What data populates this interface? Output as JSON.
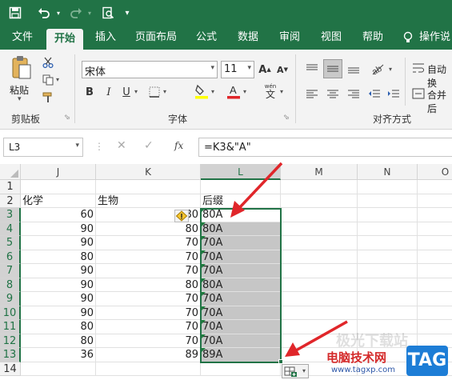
{
  "qat": {
    "icons": [
      "save-icon",
      "undo-icon",
      "redo-icon",
      "print-preview-icon",
      "customize-icon"
    ]
  },
  "tabs": [
    "文件",
    "开始",
    "插入",
    "页面布局",
    "公式",
    "数据",
    "审阅",
    "视图",
    "帮助",
    "操作说"
  ],
  "ribbon": {
    "clipboard": {
      "paste_label": "粘贴",
      "group_label": "剪贴板"
    },
    "font": {
      "font_name": "宋体",
      "font_size": "11",
      "group_label": "字体",
      "bold": "B",
      "italic": "I",
      "underline": "U",
      "wen": "wén",
      "wen_char": "文",
      "grow": "A",
      "shrink": "A"
    },
    "alignment": {
      "wrap_label": "自动换",
      "merge_label": "合并后",
      "group_label": "对齐方式"
    }
  },
  "formula_bar": {
    "name_box": "L3",
    "fx": "fx",
    "formula": "=K3&\"A\""
  },
  "grid": {
    "columns": [
      "J",
      "K",
      "L",
      "M",
      "N",
      "O"
    ],
    "rows": [
      "1",
      "2",
      "3",
      "4",
      "5",
      "6",
      "7",
      "8",
      "9",
      "10",
      "11",
      "12",
      "13",
      "14"
    ],
    "headers": {
      "J": "化学",
      "K": "生物",
      "L": "后缀"
    },
    "J_values": [
      "60",
      "90",
      "90",
      "80",
      "90",
      "90",
      "90",
      "90",
      "80",
      "80",
      "36"
    ],
    "K_values": [
      "80",
      "80",
      "70",
      "70",
      "70",
      "80",
      "70",
      "70",
      "70",
      "70",
      "89"
    ],
    "L_values": [
      "80A",
      "80A",
      "70A",
      "70A",
      "70A",
      "80A",
      "70A",
      "70A",
      "70A",
      "70A",
      "89A"
    ]
  },
  "colors": {
    "accent": "#217346",
    "arrow": "#e0262a",
    "selection": "#c6c6c6"
  },
  "watermark": {
    "site": "电脑技术网",
    "url": "www.tagxp.com",
    "badge": "TAG",
    "faded": "极光下载站"
  }
}
